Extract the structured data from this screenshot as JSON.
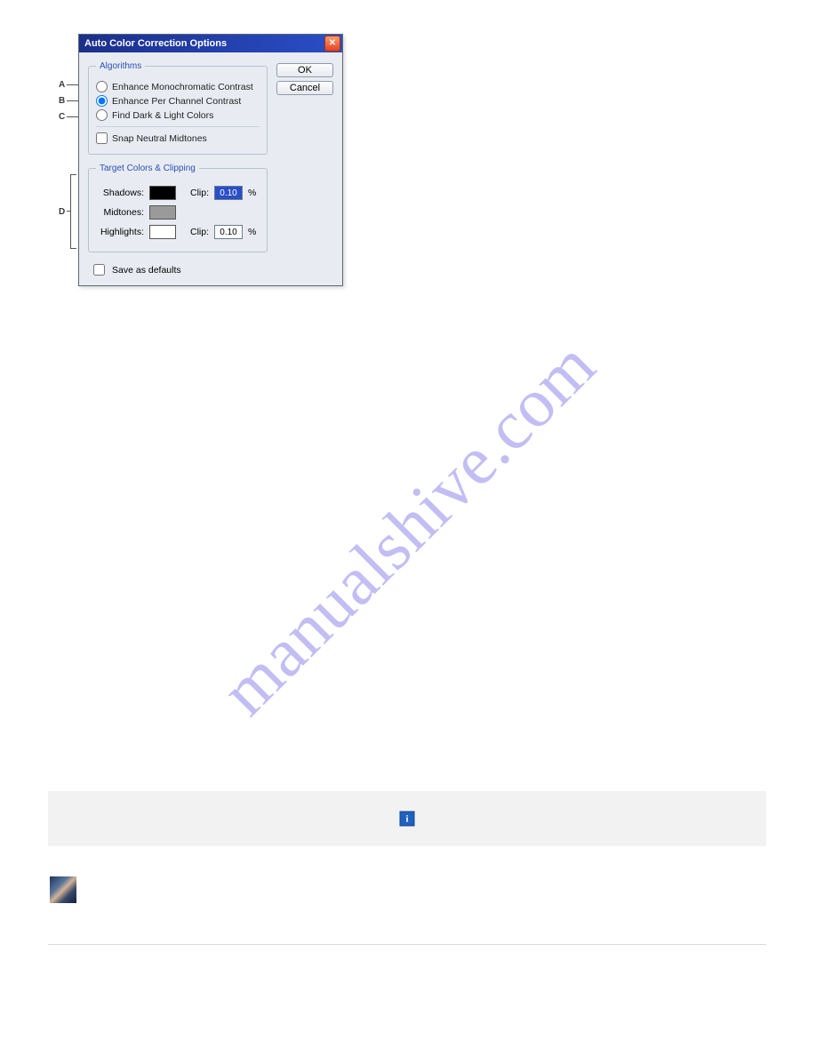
{
  "watermark": "manualshive.com",
  "dialog": {
    "title": "Auto Color Correction Options",
    "close_glyph": "✕",
    "ok_label": "OK",
    "cancel_label": "Cancel",
    "algorithms_legend": "Algorithms",
    "radio_mono": "Enhance Monochromatic Contrast",
    "radio_perchannel": "Enhance Per Channel Contrast",
    "radio_darklight": "Find Dark & Light Colors",
    "snap_neutral": "Snap Neutral Midtones",
    "target_legend": "Target Colors & Clipping",
    "shadows_label": "Shadows:",
    "midtones_label": "Midtones:",
    "highlights_label": "Highlights:",
    "clip_label": "Clip:",
    "percent": "%",
    "shadows_clip": "0.10",
    "highlights_clip": "0.10",
    "save_defaults": "Save as defaults",
    "swatches": {
      "shadows": "#000000",
      "midtones": "#9a9a9a",
      "highlights": "#ffffff"
    }
  },
  "labels": {
    "A": "A",
    "B": "B",
    "C": "C",
    "D": "D"
  },
  "info_icon_glyph": "i"
}
